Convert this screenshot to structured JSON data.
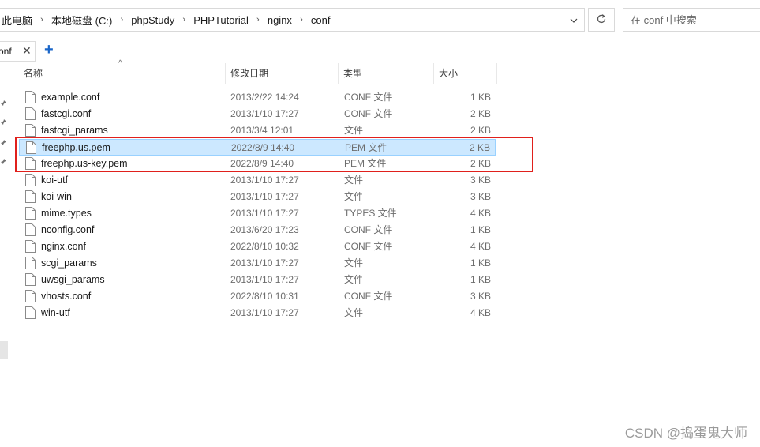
{
  "address_bar": {
    "breadcrumbs": [
      "此电脑",
      "本地磁盘 (C:)",
      "phpStudy",
      "PHPTutorial",
      "nginx",
      "conf"
    ]
  },
  "search": {
    "placeholder": "在 conf 中搜索"
  },
  "tab": {
    "label": "onf"
  },
  "columns": {
    "name": "名称",
    "date": "修改日期",
    "type": "类型",
    "size": "大小"
  },
  "files": [
    {
      "name": "example.conf",
      "date": "2013/2/22 14:24",
      "type": "CONF 文件",
      "size": "1 KB",
      "selected": false
    },
    {
      "name": "fastcgi.conf",
      "date": "2013/1/10 17:27",
      "type": "CONF 文件",
      "size": "2 KB",
      "selected": false
    },
    {
      "name": "fastcgi_params",
      "date": "2013/3/4 12:01",
      "type": "文件",
      "size": "2 KB",
      "selected": false
    },
    {
      "name": "freephp.us.pem",
      "date": "2022/8/9 14:40",
      "type": "PEM 文件",
      "size": "2 KB",
      "selected": true
    },
    {
      "name": "freephp.us-key.pem",
      "date": "2022/8/9 14:40",
      "type": "PEM 文件",
      "size": "2 KB",
      "selected": false
    },
    {
      "name": "koi-utf",
      "date": "2013/1/10 17:27",
      "type": "文件",
      "size": "3 KB",
      "selected": false
    },
    {
      "name": "koi-win",
      "date": "2013/1/10 17:27",
      "type": "文件",
      "size": "3 KB",
      "selected": false
    },
    {
      "name": "mime.types",
      "date": "2013/1/10 17:27",
      "type": "TYPES 文件",
      "size": "4 KB",
      "selected": false
    },
    {
      "name": "nconfig.conf",
      "date": "2013/6/20 17:23",
      "type": "CONF 文件",
      "size": "1 KB",
      "selected": false
    },
    {
      "name": "nginx.conf",
      "date": "2022/8/10 10:32",
      "type": "CONF 文件",
      "size": "4 KB",
      "selected": false
    },
    {
      "name": "scgi_params",
      "date": "2013/1/10 17:27",
      "type": "文件",
      "size": "1 KB",
      "selected": false
    },
    {
      "name": "uwsgi_params",
      "date": "2013/1/10 17:27",
      "type": "文件",
      "size": "1 KB",
      "selected": false
    },
    {
      "name": "vhosts.conf",
      "date": "2022/8/10 10:31",
      "type": "CONF 文件",
      "size": "3 KB",
      "selected": false
    },
    {
      "name": "win-utf",
      "date": "2013/1/10 17:27",
      "type": "文件",
      "size": "4 KB",
      "selected": false
    }
  ],
  "annotation": {
    "color": "#e0201c"
  },
  "watermark": "CSDN @捣蛋鬼大师",
  "colors": {
    "selection_bg": "#cce8ff",
    "selection_border": "#99d1ff",
    "accent": "#1a66c9"
  }
}
